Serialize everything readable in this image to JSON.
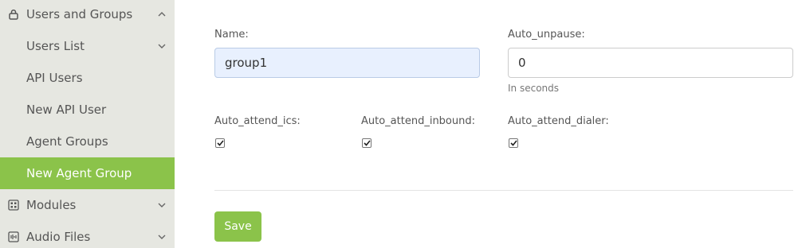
{
  "sidebar": {
    "users_and_groups": {
      "label": "Users and Groups",
      "icon": "lock-icon"
    },
    "users_list": {
      "label": "Users List"
    },
    "api_users": {
      "label": "API Users"
    },
    "new_api_user": {
      "label": "New API User"
    },
    "agent_groups": {
      "label": "Agent Groups"
    },
    "new_agent_group": {
      "label": "New Agent Group"
    },
    "modules": {
      "label": "Modules",
      "icon": "grid-icon"
    },
    "audio_files": {
      "label": "Audio Files",
      "icon": "audio-file-icon"
    }
  },
  "form": {
    "name": {
      "label": "Name:",
      "value": "group1"
    },
    "auto_unpause": {
      "label": "Auto_unpause:",
      "value": "0",
      "hint": "In seconds"
    },
    "auto_attend_ics": {
      "label": "Auto_attend_ics:",
      "checked": true
    },
    "auto_attend_inbound": {
      "label": "Auto_attend_inbound:",
      "checked": true
    },
    "auto_attend_dialer": {
      "label": "Auto_attend_dialer:",
      "checked": true
    },
    "save_label": "Save"
  },
  "colors": {
    "accent": "#8bc34a",
    "sidebar_bg": "#e6e7e1",
    "input_filled_bg": "#e8f0fe"
  }
}
